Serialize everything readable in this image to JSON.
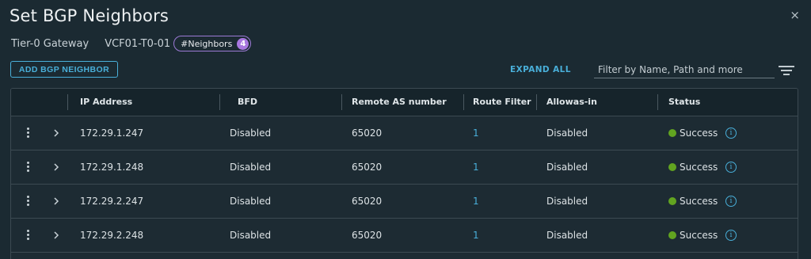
{
  "dialog": {
    "title": "Set BGP Neighbors",
    "close_icon": "×",
    "gateway_label": "Tier-0 Gateway",
    "gateway_name": "VCF01-T0-01",
    "neighbors_tag": "#Neighbors",
    "neighbors_count": "4"
  },
  "toolbar": {
    "add_label": "ADD BGP NEIGHBOR",
    "expand_all_label": "EXPAND ALL",
    "filter_placeholder": "Filter by Name, Path and more"
  },
  "table": {
    "headers": [
      "IP Address",
      "BFD",
      "Remote AS number",
      "Route Filter",
      "Allowas-in",
      "Status"
    ],
    "rows": [
      {
        "ip": "172.29.1.247",
        "bfd": "Disabled",
        "remote_as": "65020",
        "route_filter": "1",
        "allowas_in": "Disabled",
        "status": "Success"
      },
      {
        "ip": "172.29.1.248",
        "bfd": "Disabled",
        "remote_as": "65020",
        "route_filter": "1",
        "allowas_in": "Disabled",
        "status": "Success"
      },
      {
        "ip": "172.29.2.247",
        "bfd": "Disabled",
        "remote_as": "65020",
        "route_filter": "1",
        "allowas_in": "Disabled",
        "status": "Success"
      },
      {
        "ip": "172.29.2.248",
        "bfd": "Disabled",
        "remote_as": "65020",
        "route_filter": "1",
        "allowas_in": "Disabled",
        "status": "Success"
      }
    ]
  },
  "icons": {
    "close": "close-icon",
    "filter": "filter-icon",
    "row_actions": "kebab-menu-icon",
    "expand_row": "chevron-right-icon",
    "status": "success-status-dot-icon",
    "info": "info-icon"
  },
  "colors": {
    "background": "#1b2a32",
    "accent": "#49afd9",
    "tag_purple": "#a878e0",
    "success": "#62a420"
  }
}
